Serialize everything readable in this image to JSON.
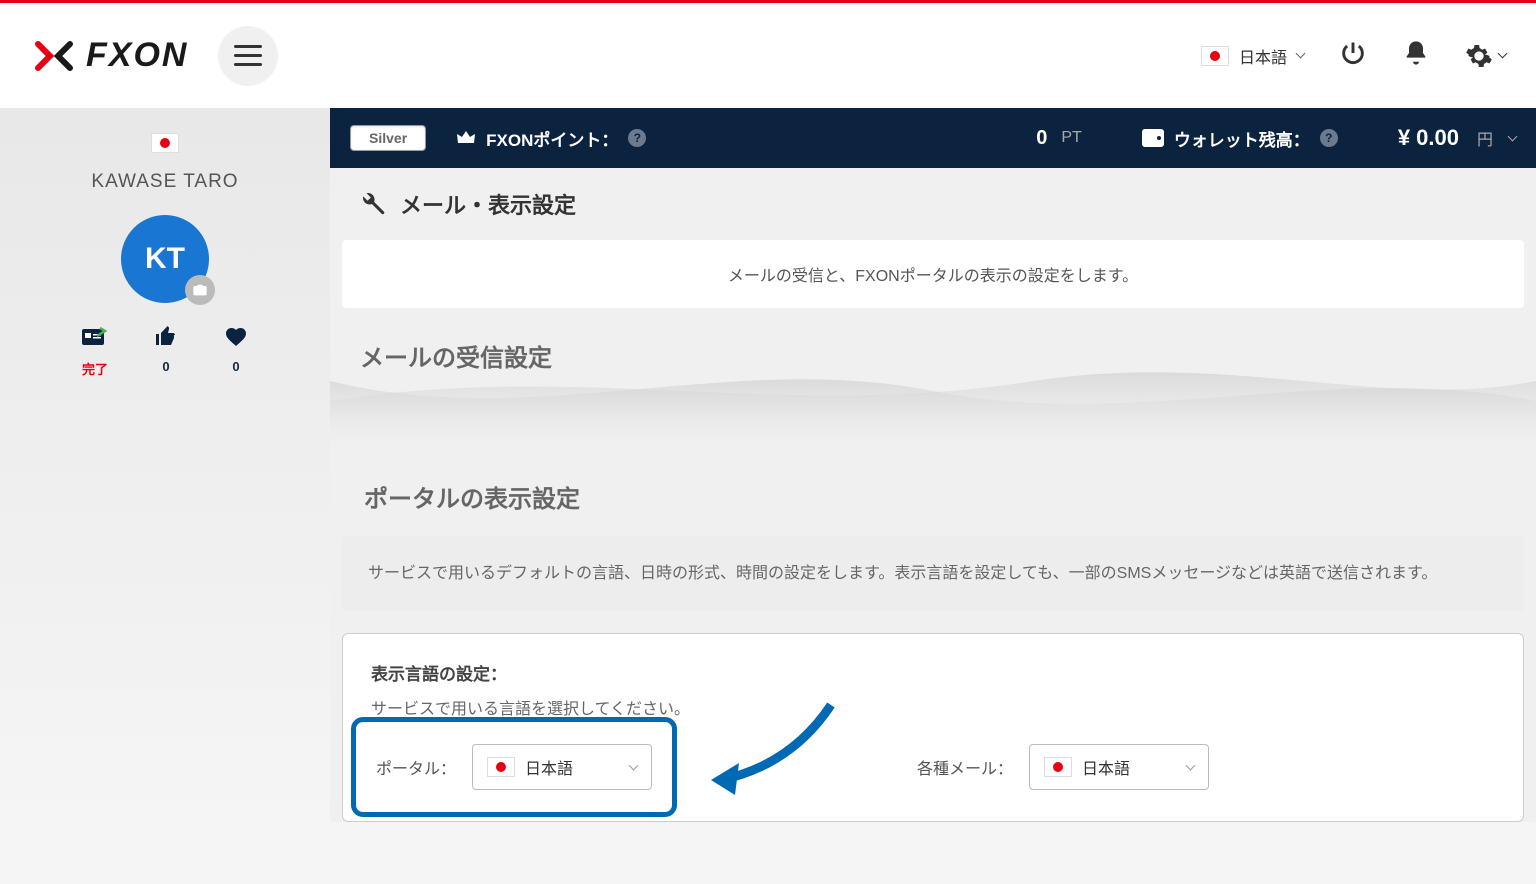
{
  "header": {
    "logo_text": "FXON",
    "language": "日本語"
  },
  "sidebar": {
    "username": "KAWASE TARO",
    "initials": "KT",
    "stats": {
      "verify": "完了",
      "likes": "0",
      "favorites": "0"
    }
  },
  "topbar": {
    "tier": "Silver",
    "points_label": "FXONポイント：",
    "points_value": "0",
    "points_unit": "PT",
    "wallet_label": "ウォレット残高：",
    "wallet_value": "¥ 0.00",
    "wallet_unit": "円"
  },
  "page": {
    "title": "メール・表示設定",
    "description": "メールの受信と、FXONポータルの表示の設定をします。",
    "mail_section": "メールの受信設定",
    "portal_section": "ポータルの表示設定",
    "portal_desc": "サービスで用いるデフォルトの言語、日時の形式、時間の設定をします。表示言語を設定しても、一部のSMSメッセージなどは英語で送信されます。",
    "display_lang_label": "表示言語の設定：",
    "display_lang_sublabel": "サービスで用いる言語を選択してください。",
    "portal_label": "ポータル：",
    "portal_value": "日本語",
    "mail_label": "各種メール：",
    "mail_value": "日本語"
  }
}
